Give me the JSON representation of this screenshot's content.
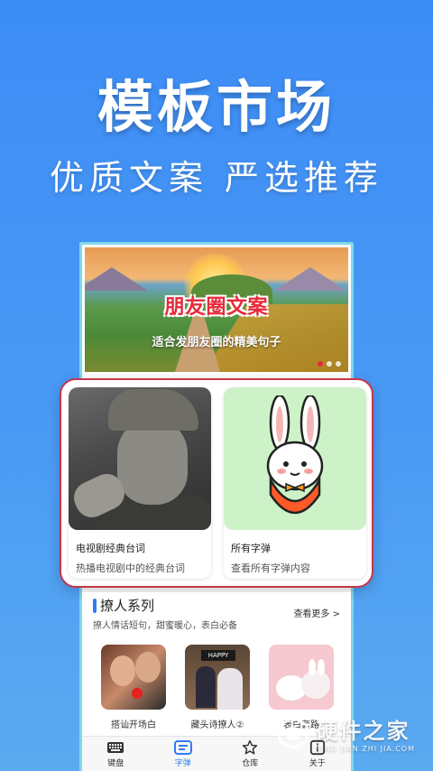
{
  "hero": {
    "title": "模板市场",
    "subtitle": "优质文案 严选推荐"
  },
  "banner": {
    "title": "朋友圈文案",
    "subtitle": "适合发朋友圈的精美句子",
    "page_count": 3,
    "active_page": 1
  },
  "cards": [
    {
      "title": "电视剧经典台词",
      "desc": "热播电视剧中的经典台词",
      "image": "man-pointing-photo"
    },
    {
      "title": "所有字弹",
      "desc": "查看所有字弹内容",
      "image": "rabbit-mascot"
    }
  ],
  "section": {
    "title": "撩人系列",
    "desc": "撩人情话短句，甜蜜暖心，表白必备",
    "more": "查看更多 >",
    "items": [
      {
        "label": "搭讪开场白"
      },
      {
        "label": "藏头诗撩人②",
        "badge": "HAPPY"
      },
      {
        "label": "表白套路"
      }
    ]
  },
  "tabbar": {
    "items": [
      {
        "label": "键盘",
        "icon": "keyboard-icon"
      },
      {
        "label": "字弹",
        "icon": "text-list-icon"
      },
      {
        "label": "仓库",
        "icon": "star-icon"
      },
      {
        "label": "关于",
        "icon": "info-icon"
      }
    ],
    "active": 1
  },
  "watermark": {
    "name": "硬件之家",
    "url": "YING JIAN ZHI JIA.COM"
  },
  "colors": {
    "background": "#3c8cf6",
    "accent": "#2f7cf6",
    "highlight_border": "#c7364a",
    "banner_title": "#e8283a"
  }
}
